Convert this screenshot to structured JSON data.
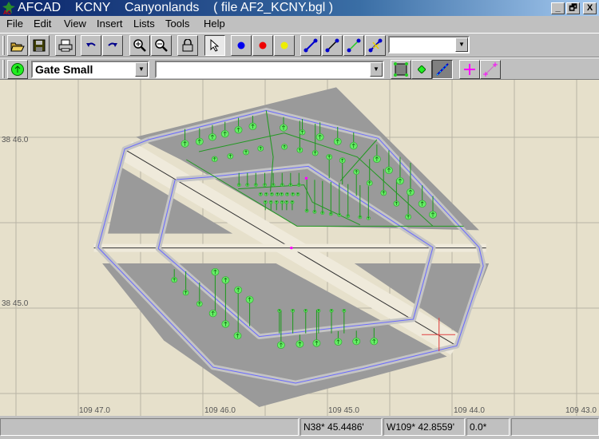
{
  "window": {
    "title": "AFCAD    KCNY    Canyonlands    ( file AF2_KCNY.bgl )",
    "minimize": "_",
    "restore": "🗗",
    "close": "X"
  },
  "menu": [
    "File",
    "Edit",
    "View",
    "Insert",
    "Lists",
    "Tools",
    "Help"
  ],
  "toolbar1": {
    "buttons": [
      "open-icon",
      "save-icon",
      "print-icon",
      "undo-icon",
      "redo-icon",
      "zoom-in-icon",
      "zoom-out-icon",
      "lock-icon",
      "select-arrow-icon",
      "blue-node-icon",
      "red-node-icon",
      "yellow-node-icon",
      "path-blue-icon",
      "path-black-icon",
      "path-green-icon",
      "path-split-icon"
    ],
    "combo_value": ""
  },
  "toolbar2": {
    "object_type": "Gate Small",
    "second_combo": "",
    "buttons": [
      "apron-icon",
      "vertex-icon",
      "taxi-link-icon",
      "add-point-icon",
      "add-link-icon"
    ]
  },
  "map": {
    "lat_labels": [
      "38 46.0",
      "38 45.0"
    ],
    "lon_labels": [
      "109 47.0",
      "109 46.0",
      "109 45.0",
      "109 44.0",
      "109 43.0"
    ],
    "colors": {
      "background": "#e6e0cb",
      "apron": "#9a9a9a",
      "gate": "#66ee66",
      "taxi_link": "#229922"
    }
  },
  "status": {
    "lat": "N38* 45.4486'",
    "lon": "W109* 42.8559'",
    "heading": "0.0*"
  }
}
